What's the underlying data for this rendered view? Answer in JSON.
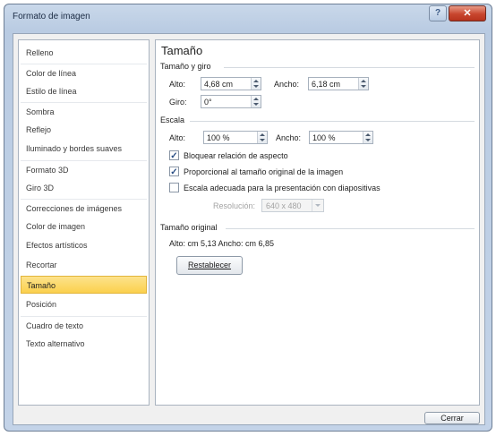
{
  "window": {
    "title": "Formato de imagen",
    "help_glyph": "?",
    "close_glyph": "✕"
  },
  "sidebar": {
    "items": [
      {
        "label": "Relleno"
      },
      {
        "label": "Color de línea"
      },
      {
        "label": "Estilo de línea"
      },
      {
        "label": "Sombra"
      },
      {
        "label": "Reflejo"
      },
      {
        "label": "Iluminado y bordes suaves"
      },
      {
        "label": "Formato 3D"
      },
      {
        "label": "Giro 3D"
      },
      {
        "label": "Correcciones de imágenes"
      },
      {
        "label": "Color de imagen"
      },
      {
        "label": "Efectos artísticos"
      },
      {
        "label": "Recortar"
      },
      {
        "label": "Tamaño",
        "selected": true
      },
      {
        "label": "Posición"
      },
      {
        "label": "Cuadro de texto"
      },
      {
        "label": "Texto alternativo"
      }
    ]
  },
  "panel": {
    "title": "Tamaño",
    "size_rotation": {
      "label": "Tamaño y giro",
      "alto_label": "Alto:",
      "alto_value": "4,68 cm",
      "ancho_label": "Ancho:",
      "ancho_value": "6,18 cm",
      "giro_label": "Giro:",
      "giro_value": "0°"
    },
    "scale": {
      "label": "Escala",
      "alto_label": "Alto:",
      "alto_value": "100 %",
      "ancho_label": "Ancho:",
      "ancho_value": "100 %",
      "lock_aspect_label": "Bloquear relación de aspecto",
      "lock_aspect_checked": true,
      "relative_label": "Proporcional al tamaño original de la imagen",
      "relative_checked": true,
      "best_scale_label": "Escala adecuada para la presentación con diapositivas",
      "best_scale_checked": false,
      "resolution_label": "Resolución:",
      "resolution_value": "640 x 480"
    },
    "original": {
      "label": "Tamaño original",
      "text": "Alto:  cm 5,13   Ancho:   cm 6,85",
      "reset_label": "Restablecer"
    }
  },
  "footer": {
    "close_label": "Cerrar"
  }
}
